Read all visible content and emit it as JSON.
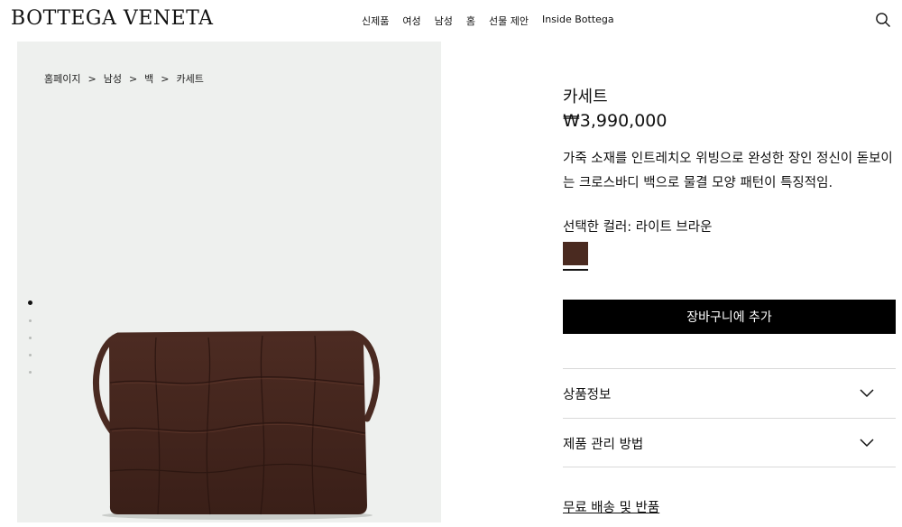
{
  "header": {
    "logo": "BOTTEGA VENETA",
    "nav": [
      "신제품",
      "여성",
      "남성",
      "홈",
      "선물 제안",
      "Inside Bottega"
    ],
    "search_icon": "search-icon"
  },
  "gallery": {
    "breadcrumb": [
      "홈페이지",
      "남성",
      "백",
      "카세트"
    ],
    "breadcrumb_separator": ">",
    "image_count": 5,
    "active_index": 0
  },
  "product": {
    "title": "카세트",
    "price": "₩3,990,000",
    "description": "가죽 소재를 인트레치오 위빙으로 완성한 장인 정신이 돋보이는 크로스바디 백으로 물결 모양 패턴이 특징적임.",
    "color_label": "선택한 컬러: 라이트 브라운",
    "swatch_color": "#4a2a20",
    "add_to_cart_label": "장바구니에 추가",
    "accordion": [
      {
        "label": "상품정보",
        "icon": "chevron-down-icon"
      },
      {
        "label": "제품 관리 방법",
        "icon": "chevron-down-icon"
      }
    ],
    "shipping_link": "무료 배송 및 반품"
  }
}
